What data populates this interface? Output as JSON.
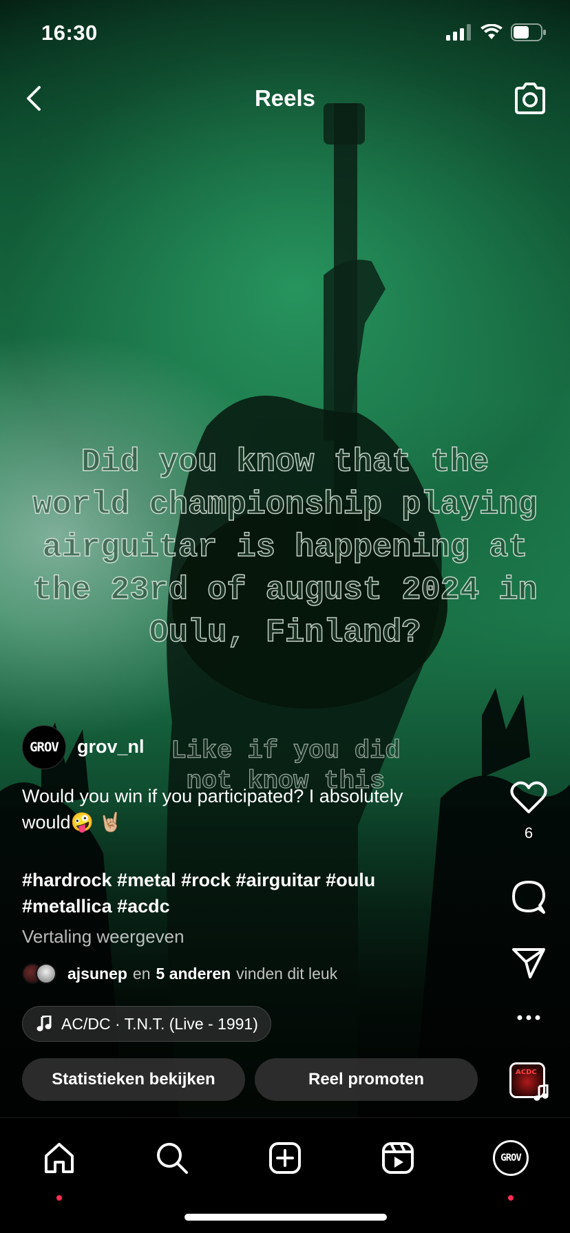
{
  "status_bar": {
    "time": "16:30"
  },
  "header": {
    "title": "Reels"
  },
  "overlay": {
    "main_text": "Did you know that the\nworld championship playing\nairguitar is happening at\nthe 23rd of august 2024 in\nOulu, Finland?",
    "sub_text": "Like if you did\nnot know this"
  },
  "post": {
    "author": "grov_nl",
    "avatar_text": "GROV",
    "caption": "Would you win if you participated? I absolutely would🤪 🤘🏼",
    "hashtags": "#hardrock #metal #rock #airguitar #oulu #metallica #acdc",
    "translate_label": "Vertaling weergeven",
    "liked_by": {
      "user": "ajsunep",
      "connector": "en",
      "others": "5 anderen",
      "suffix": "vinden dit leuk"
    },
    "music": "AC/DC · T.N.T. (Live - 1991)"
  },
  "actions": {
    "stats_label": "Statistieken bekijken",
    "promote_label": "Reel promoten"
  },
  "rail": {
    "like_count": "6",
    "icons": [
      "heart-icon",
      "comment-icon",
      "share-icon",
      "more-icon",
      "audio-thumbnail"
    ]
  },
  "bottom_nav": {
    "items": [
      "home-icon",
      "search-icon",
      "create-icon",
      "reels-icon",
      "profile-avatar"
    ],
    "profile_text": "GROV"
  },
  "colors": {
    "notification_dot": "#ff2d55",
    "scene_green": "#1f8a55"
  }
}
